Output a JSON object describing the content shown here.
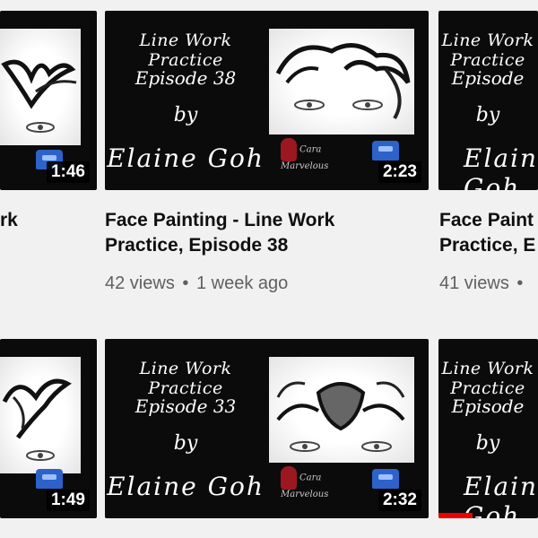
{
  "thumbnail_text": {
    "line1": "Line Work Practice",
    "by": "by",
    "author": "Elaine Goh"
  },
  "videos": [
    {
      "duration": "1:46",
      "title_line1": "",
      "title_line2": "rk",
      "views": "",
      "age": ""
    },
    {
      "episode": "Episode 38",
      "duration": "2:23",
      "title_line1": "Face Painting - Line Work",
      "title_line2": "Practice, Episode 38",
      "views": "42 views",
      "separator": "•",
      "age": "1 week ago"
    },
    {
      "episode": "Episode",
      "duration": "",
      "title_line1": "Face Paint",
      "title_line2": "Practice, E",
      "views": "41 views",
      "separator": "•",
      "age": ""
    },
    {
      "duration": "1:49"
    },
    {
      "episode": "Episode 33",
      "duration": "2:32"
    },
    {
      "episode": "Episode",
      "duration": ""
    }
  ],
  "colors": {
    "background": "#f1f1f1",
    "thumbnail_bg": "#0b0b0b",
    "title_text": "#0f0f0f",
    "meta_text": "#606060",
    "progress_red": "#ee0000",
    "logo_blue": "#2c62c9"
  },
  "icons": {
    "watermark": "channel-watermark-icon",
    "brand": "brand-logo"
  }
}
